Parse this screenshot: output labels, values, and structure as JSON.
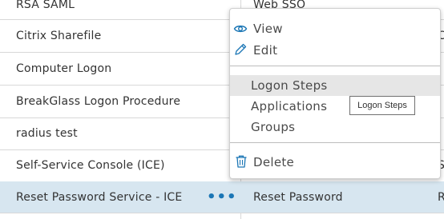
{
  "table": {
    "rows": [
      {
        "name": "RSA SAML",
        "type": "Web SSO",
        "edge": ""
      },
      {
        "name": "Citrix Sharefile",
        "type": "",
        "edge": "C"
      },
      {
        "name": "Computer Logon",
        "type": "",
        "edge": ""
      },
      {
        "name": "BreakGlass Logon Procedure",
        "type": "",
        "edge": ""
      },
      {
        "name": "radius test",
        "type": "",
        "edge": ""
      },
      {
        "name": "Self-Service Console (ICE)",
        "type": "",
        "edge": "S"
      },
      {
        "name": "Reset Password Service - ICE",
        "type": "Reset Password",
        "edge": "R",
        "actions": "•••"
      }
    ]
  },
  "context_menu": {
    "view": "View",
    "edit": "Edit",
    "logon_steps": "Logon Steps",
    "applications": "Applications",
    "groups": "Groups",
    "delete": "Delete"
  },
  "tooltip": {
    "text": "Logon Steps"
  },
  "colors": {
    "accent": "#1b76b5",
    "selected_row": "#d7e6f0",
    "menu_hover": "#e6e6e6"
  },
  "icons": [
    "eye-icon",
    "pencil-icon",
    "trash-icon"
  ]
}
